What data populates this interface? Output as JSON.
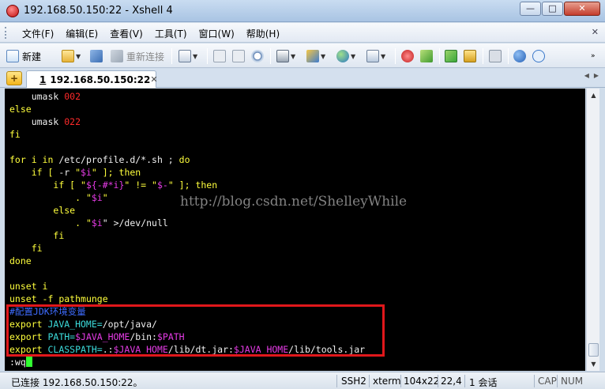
{
  "window": {
    "title": "192.168.50.150:22 - Xshell 4",
    "buttons": {
      "minimize": "—",
      "maximize": "□",
      "close": "✕"
    }
  },
  "menu": {
    "items": [
      "文件(F)",
      "编辑(E)",
      "查看(V)",
      "工具(T)",
      "窗口(W)",
      "帮助(H)"
    ],
    "close": "✕"
  },
  "toolbar": {
    "new_label": "新建",
    "reconnect_label": "重新连接"
  },
  "tab": {
    "add": "+",
    "number": "1",
    "label": "192.168.50.150:22",
    "close": "✕",
    "nav_left": "◀",
    "nav_right": "▶"
  },
  "terminal": {
    "lines": [
      {
        "indent": "    ",
        "a": "umask",
        "b": " 002",
        "c": ""
      },
      {
        "indent": "",
        "a": "else",
        "b": "",
        "c": ""
      },
      {
        "indent": "    ",
        "a": "umask",
        "b": " 022",
        "c": ""
      },
      {
        "indent": "",
        "a": "fi",
        "b": "",
        "c": ""
      },
      {
        "indent": "",
        "a": "",
        "b": "",
        "c": ""
      },
      {
        "indent": "",
        "a": "for i ",
        "b": "in",
        "c": " /etc/profile.d/*.sh ; ",
        "d": "do"
      },
      {
        "indent": "    ",
        "a": "if [ ",
        "b": "-r",
        "c": " \"",
        "d": "$i",
        "e": "\" ]; ",
        "f": "then"
      },
      {
        "indent": "        ",
        "a": "if [ \"",
        "b": "${-#*i}",
        "c": "\" != \"",
        "d": "$-",
        "e": "\" ]; ",
        "f": "then"
      },
      {
        "indent": "            ",
        "a": ". \"",
        "b": "$i",
        "c": "\""
      },
      {
        "indent": "        ",
        "a": "else",
        "b": "",
        "c": ""
      },
      {
        "indent": "            ",
        "a": ". \"",
        "b": "$i",
        "c": "\" >/dev/null"
      },
      {
        "indent": "        ",
        "a": "fi",
        "b": "",
        "c": ""
      },
      {
        "indent": "    ",
        "a": "fi",
        "b": "",
        "c": ""
      },
      {
        "indent": "",
        "a": "done",
        "b": "",
        "c": ""
      },
      {
        "indent": "",
        "a": "",
        "b": "",
        "c": ""
      },
      {
        "indent": "",
        "a": "unset i",
        "b": "",
        "c": ""
      },
      {
        "indent": "",
        "a": "unset ",
        "b": "-f",
        "c": " pathmunge"
      },
      {
        "indent": "",
        "a": "#配置JDK环境变量",
        "b": "",
        "c": ""
      },
      {
        "indent": "",
        "a": "export ",
        "b": "JAVA_HOME=",
        "c": "/opt/java/"
      },
      {
        "indent": "",
        "a": "export ",
        "b": "PATH=",
        "c": "$JAVA_HOME",
        "d": "/bin:",
        "e": "$PATH"
      },
      {
        "indent": "",
        "a": "export ",
        "b": "CLASSPATH=",
        "c": ".:",
        "d": "$JAVA_HOME",
        "e": "/lib/dt.jar:",
        "f": "$JAVA_HOME",
        "g": "/lib/tools.jar"
      },
      {
        "indent": "",
        "a": ":wq",
        "b": "",
        "c": ""
      }
    ],
    "watermark": "http://blog.csdn.net/ShelleyWhile"
  },
  "status": {
    "connection": "已连接 192.168.50.150:22。",
    "protocol": "SSH2",
    "term": "xterm",
    "size": "104x22",
    "pos": "22,4",
    "sessions": "1 会话",
    "cap": "CAP",
    "num": "NUM"
  },
  "colors": {
    "terminal_bg": "#000000",
    "highlight_box": "#e0171b",
    "cursor": "#31ff31"
  }
}
